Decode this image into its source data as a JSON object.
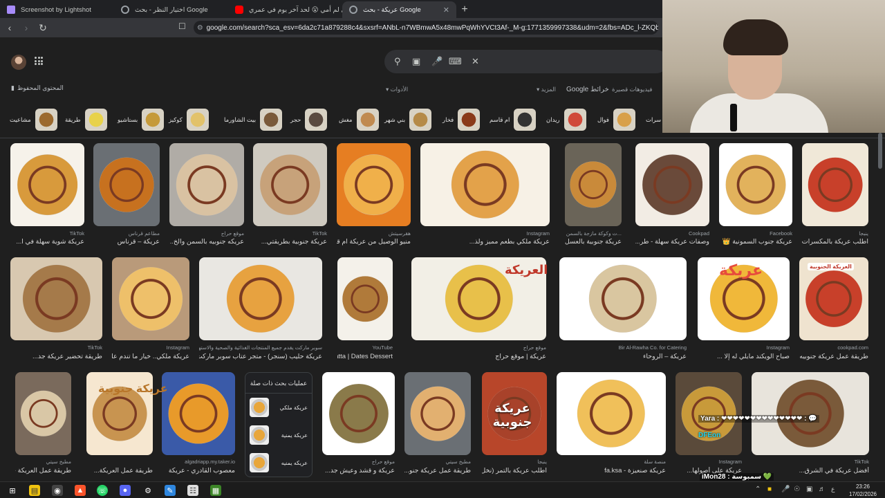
{
  "tabs": [
    {
      "title": "Screenshot by Lightshot",
      "favicon_color": "#a78bfa"
    },
    {
      "title": "اختيار النظر - بحث Google",
      "favicon_color": "#9aa0a6"
    },
    {
      "title": "أمي لم أمي 😮 لحد آخر يوم في عمري 😮",
      "favicon_color": "#ff0000"
    },
    {
      "title": "عريكة - بحث Google",
      "favicon_color": "#9aa0a6"
    }
  ],
  "new_tab": "+",
  "close_tab": "✕",
  "address": {
    "url": "google.com/search?sca_esv=6da2c71a879288c4&sxsrf=ANbL-n7WBmwA5x48mwPqWhYVCt3Af-_M-g:1771359997338&udm=2&fbs=ADc_l-ZKQbPB6vNN..."
  },
  "search": {
    "clear_label": "✕"
  },
  "saved_label": "المحتوى المحفوظ",
  "tools": {
    "tools_label": "الأدوات",
    "more_label": "المزيد",
    "google_label": "Google",
    "maps_label": "خرائط",
    "videos_label": "فيديوهات قصيرة"
  },
  "chips": [
    "مشاعيت",
    "طريقة",
    "بستاشيو",
    "كوكيز",
    "بيت الشاورما",
    "حجر",
    "مغش",
    "بني شهر",
    "فخار",
    "ام قاسم",
    "ريدان",
    "فوال",
    "سرات"
  ],
  "chip_colors": [
    "#9c6a2e",
    "#e8d24a",
    "#c59a3a",
    "#e2c26a",
    "#7a5a3a",
    "#5a4a40",
    "#c08a50",
    "#b58a48",
    "#8a3a1a",
    "#333333",
    "#d04a3a",
    "#d8a04a",
    "#b07830"
  ],
  "row1": [
    {
      "source": "ينبجا",
      "caption": "اطلب عريكة بالمكسرات من..."
    },
    {
      "source": "Facebook",
      "caption": "عريكة جنوب السمونية 👑"
    },
    {
      "source": "Cookpad",
      "caption": "وصفات عريكة سهلة - طر..."
    },
    {
      "source": "...ت وكوكة مازجة بالسمن الشانية",
      "caption": "عريكة جنوبية بالعسل والتم..."
    },
    {
      "source": "Instagram",
      "caption": "عريكة ملكي بطعم مميز ولذ..."
    },
    {
      "source": "هقرسيتش",
      "caption": "منيو الوصيل من عريكة ام قاسم في الموسى | ه..."
    },
    {
      "source": "TikTok",
      "caption": "عريكة جنوبية بطريقتي..."
    },
    {
      "source": "موقع حراج",
      "caption": "عريكه جنوبيه بالسمن والخ..."
    },
    {
      "source": "مطاعم قرناس",
      "caption": "عريكة – قرناس"
    },
    {
      "source": "TikTok",
      "caption": "عريكة شوية سهلة في ا..."
    }
  ],
  "row2": [
    {
      "source": "cookpad.com",
      "caption": "طريقة عمل عريكة جنوبيه - كوكباد"
    },
    {
      "source": "Instagram",
      "caption": "صباح الويكند مايلي له إلا ..."
    },
    {
      "source": "Bir Al-Rawha Co. for Catering",
      "caption": "عريكة – الروحاء"
    },
    {
      "source": "موقع حراج",
      "caption": "عريكة | موقع حراج"
    },
    {
      "source": "YouTube",
      "caption": "Yemeni Dates Fatta | Dates Dessert - ..."
    },
    {
      "source": "سوبر ماركت يقدم جميع المنتجات الغذائية والصحية والاستهلاكية",
      "caption": "عريكة حليب (سنجر) - متجر عتاب سوبر ماركت"
    },
    {
      "source": "Instagram",
      "caption": "عريكة ملكي.. خيار ما تندم عليه..."
    },
    {
      "source": "TikTok",
      "caption": "طريقة تحضير عريكة جد..."
    }
  ],
  "row3": [
    {
      "source": "TikTok",
      "caption": "أفضل عريكة في الشرق..."
    },
    {
      "source": "Instagram",
      "caption": "عريكة على أصولها..."
    },
    {
      "source": "منصة سلة",
      "caption": "عريكة صنعيزة - fa.ksa"
    },
    {
      "source": "ينبجا",
      "caption": "اطلب عريكة بالتمر (نخل)..."
    },
    {
      "source": "مطبخ سيتي",
      "caption": "طريقة عمل عريكة جنو..."
    },
    {
      "source": "موقع حراج",
      "caption": "عريكة و قشد وعيش جد..."
    },
    {
      "source": "algadriapp.my.taker.io",
      "caption": "معصوب القادري - عريكة"
    },
    {
      "source": "",
      "caption": "طريقة عمل العريكة..."
    },
    {
      "source": "مطبخ سيتي",
      "caption": "طريقة عمل العريكة حلا سعودي ذو مذاق..."
    }
  ],
  "related": {
    "title": "عمليات بحث ذات صلة",
    "items": [
      "عريكة ملكي",
      "عريكة يمنية",
      "عريكه يمنيه"
    ]
  },
  "image_text": {
    "ariika": "العريكة",
    "ariika_janubia": "عريكة جنوبية",
    "ariika_short": "عريكة",
    "arika_red": "عريكة جنوبية",
    "ariika_beauty": "العريكة الجنوبية",
    "ariika_orange": "عريكة ملكي"
  },
  "overlay": {
    "line1": "Yara : ❤❤❤❤❤❤❤❤❤❤❤❤❤❤ : 💬",
    "line2": "DFEon",
    "line3": "iMon28 : سمبوسة 💚"
  },
  "taskbar": {
    "time": "23:26",
    "date": "17/02/2026",
    "lang": "ع"
  }
}
